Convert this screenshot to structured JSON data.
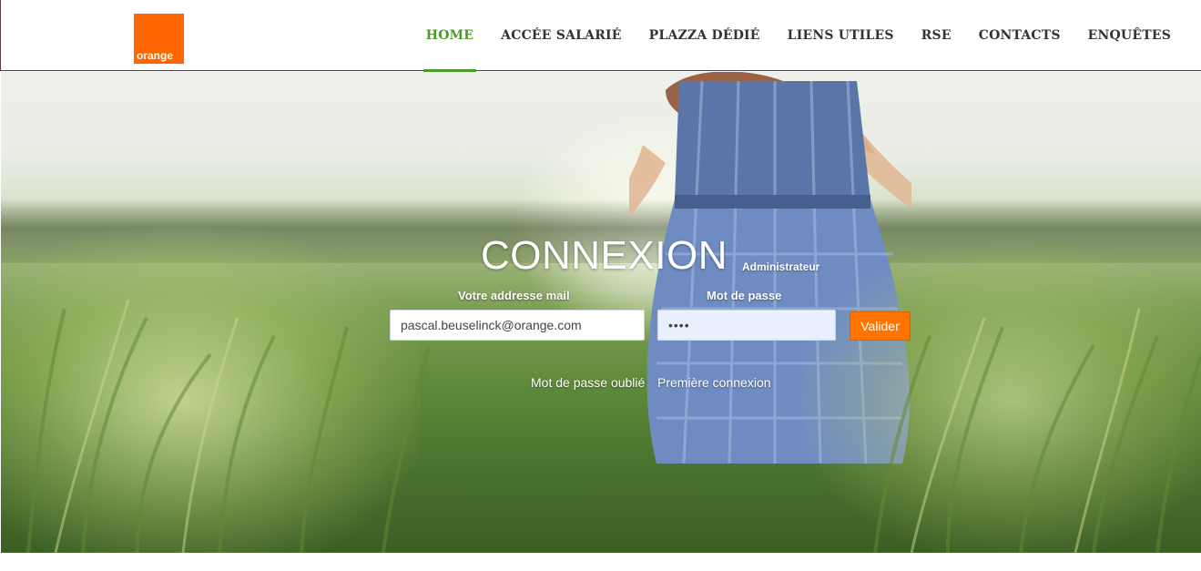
{
  "brand": {
    "logo_text": "orange",
    "color": "#ff6600"
  },
  "nav": {
    "items": [
      {
        "label": "HOME",
        "active": true
      },
      {
        "label": "ACCÉE SALARIÉ",
        "active": false
      },
      {
        "label": "PLAZZA DÉDIÉ",
        "active": false
      },
      {
        "label": "LIENS UTILES",
        "active": false
      },
      {
        "label": "RSE",
        "active": false
      },
      {
        "label": "CONTACTS",
        "active": false
      },
      {
        "label": "ENQUÊTES",
        "active": false
      }
    ],
    "active_color": "#4c9a2a"
  },
  "login": {
    "title": "CONNEXION",
    "subtitle": "Administrateur",
    "email_label": "Votre addresse mail",
    "email_value": "pascal.beuselinck@orange.com",
    "password_label": "Mot de passe",
    "password_value": "••••",
    "submit_label": "Valider",
    "forgot_link": "Mot de passe oublié",
    "first_login_link": "Première connexion",
    "accent_color": "#ff7300"
  }
}
